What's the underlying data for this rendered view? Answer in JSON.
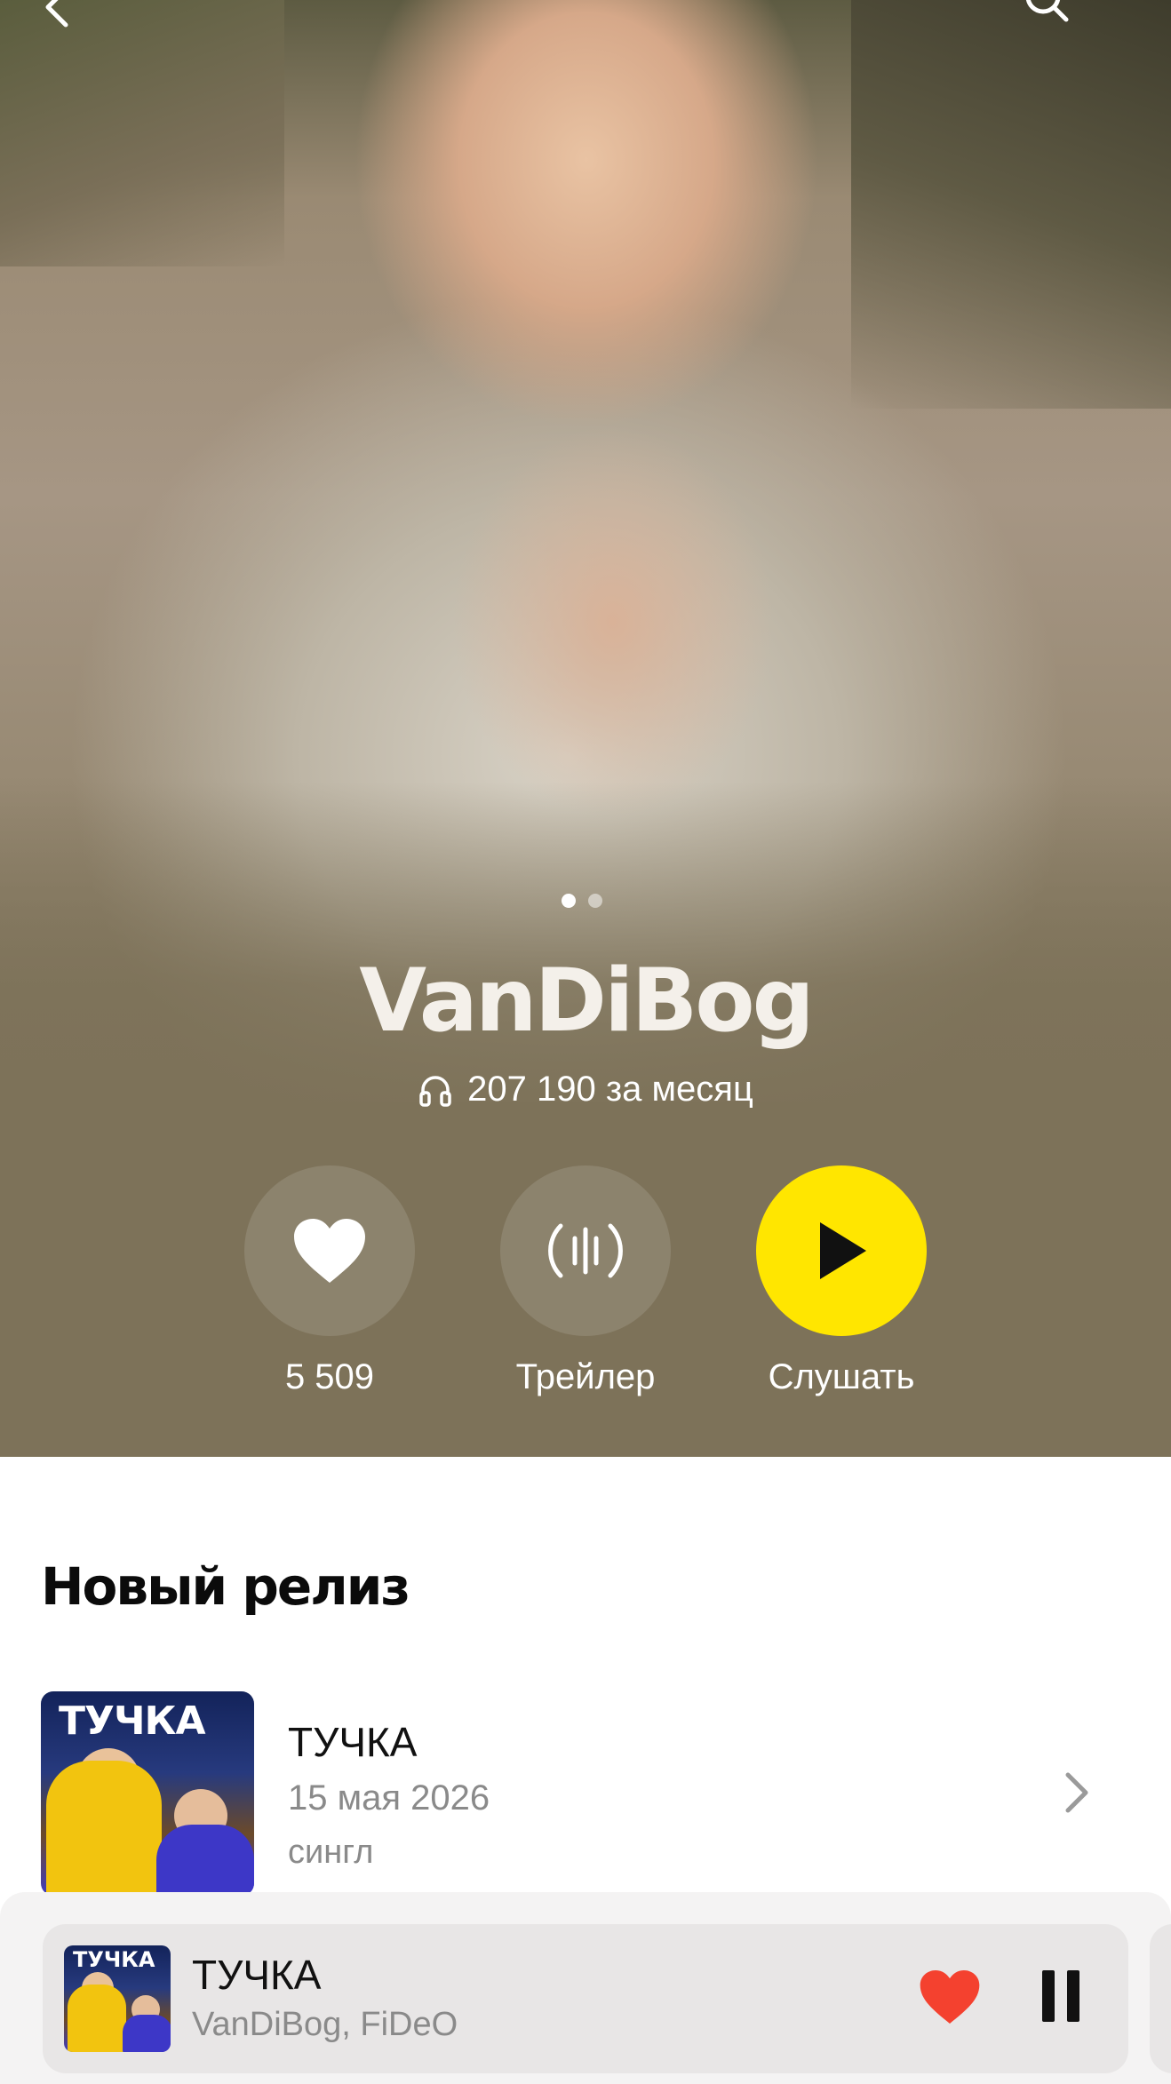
{
  "artist": {
    "name": "VanDiBog",
    "monthly_listeners": "207 190 за месяц"
  },
  "gallery": {
    "slides": 2,
    "active_slide": 1
  },
  "actions": {
    "like_count": "5 509",
    "trailer_label": "Трейлер",
    "listen_label": "Слушать"
  },
  "new_release": {
    "section_title": "Новый релиз",
    "title": "ТУЧКА",
    "date": "15 мая 2026",
    "type": "сингл",
    "cover_text": "ТУЧКА"
  },
  "mini_player": {
    "title": "ТУЧКА",
    "artists": "VanDiBog, FiDeO",
    "thumb_text": "ТУЧКА",
    "liked": true,
    "state": "playing"
  },
  "colors": {
    "hero_background": "#7d7259",
    "play_button": "#ffe600",
    "like_active": "#f4412f"
  },
  "icons": [
    "back-icon",
    "search-icon",
    "headphones-icon",
    "heart-icon",
    "trailer-icon",
    "play-icon",
    "chevron-right-icon",
    "pause-icon"
  ]
}
